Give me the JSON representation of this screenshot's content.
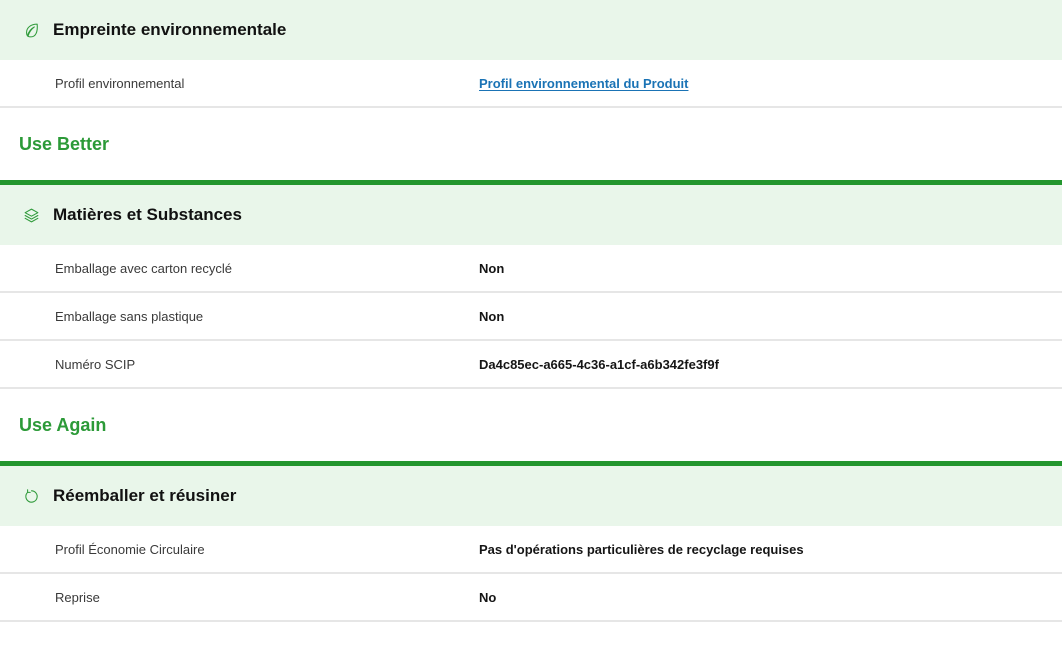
{
  "sections": [
    {
      "icon": "leaf-icon",
      "title": "Empreinte environnementale",
      "rows": [
        {
          "label": "Profil environnemental",
          "value": "Profil environnemental du Produit",
          "is_link": true
        }
      ]
    },
    {
      "group_title": "Use Better",
      "icon": "layers-icon",
      "title": "Matières et Substances",
      "rows": [
        {
          "label": "Emballage avec carton recyclé",
          "value": "Non"
        },
        {
          "label": "Emballage sans plastique",
          "value": "Non"
        },
        {
          "label": "Numéro SCIP",
          "value": "Da4c85ec-a665-4c36-a1cf-a6b342fe3f9f"
        }
      ]
    },
    {
      "group_title": "Use Again",
      "icon": "refresh-icon",
      "title": "Réemballer et réusiner",
      "rows": [
        {
          "label": "Profil Économie Circulaire",
          "value": "Pas d'opérations particulières de recyclage requises"
        },
        {
          "label": "Reprise",
          "value": "No"
        }
      ]
    }
  ],
  "colors": {
    "accent": "#23962e",
    "header_bg": "#e9f6ea",
    "link": "#1a73b5"
  }
}
